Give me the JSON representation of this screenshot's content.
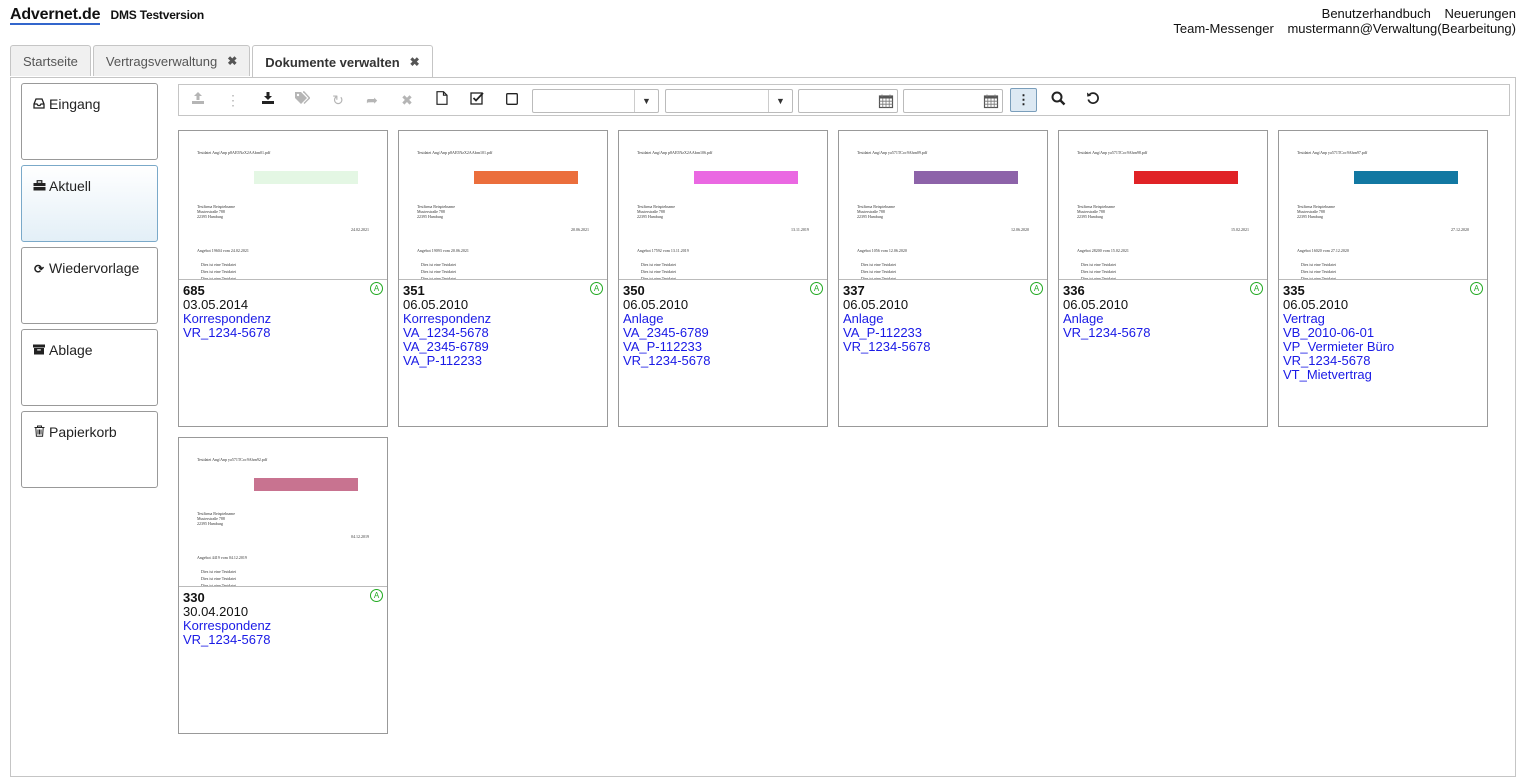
{
  "app": {
    "logo": "Advernet.de",
    "subtitle": "DMS  Testversion"
  },
  "toplinks": {
    "handbook": "Benutzerhandbuch",
    "news": "Neuerungen",
    "messenger": "Team-Messenger",
    "user": "mustermann@Verwaltung(Bearbeitung)"
  },
  "tabs": [
    {
      "label": "Startseite",
      "closable": false
    },
    {
      "label": "Vertragsverwaltung",
      "closable": true
    },
    {
      "label": "Dokumente verwalten",
      "closable": true,
      "active": true
    }
  ],
  "sidebar": [
    {
      "label": "Eingang",
      "icon": "inbox-icon"
    },
    {
      "label": "Aktuell",
      "icon": "briefcase-icon",
      "active": true
    },
    {
      "label": "Wiedervorlage",
      "icon": "refresh-icon"
    },
    {
      "label": "Ablage",
      "icon": "archive-icon"
    },
    {
      "label": "Papierkorb",
      "icon": "trash-icon"
    }
  ],
  "toolbar": {
    "filter1_value": "",
    "filter2_value": "",
    "date_from": "",
    "date_to": ""
  },
  "documents": [
    {
      "number": "685",
      "date": "03.05.2014",
      "tags": [
        "Korrespondenz",
        "VR_1234-5678"
      ],
      "color": "#e4f7e4",
      "file": "Testdatei Ang/Anp p8AE5NzX2AAbrn01.pdf",
      "angebot": "Angebot 19604 vom 24.02.2021",
      "docdate": "24.02.2021"
    },
    {
      "number": "351",
      "date": "06.05.2010",
      "tags": [
        "Korrespondenz",
        "VA_1234-5678",
        "VA_2345-6789",
        "VA_P-112233"
      ],
      "color": "#eb6e3c",
      "file": "Testdatei Ang/Anp p8AE5NzX2AAbrn101.pdf",
      "angebot": "Angebot 19093 vom 20.06.2021",
      "docdate": "20.06.2021"
    },
    {
      "number": "350",
      "date": "06.05.2010",
      "tags": [
        "Anlage",
        "VA_2345-6789",
        "VA_P-112233",
        "VR_1234-5678"
      ],
      "color": "#ea68e2",
      "file": "Testdatei Ang/Anp p8AE5NzX2AAbrn106.pdf",
      "angebot": "Angebot 17592 vom 13.11.2019",
      "docdate": "13.11.2019"
    },
    {
      "number": "337",
      "date": "06.05.2010",
      "tags": [
        "Anlage",
        "VA_P-112233",
        "VR_1234-5678"
      ],
      "color": "#8d63a9",
      "file": "Testdatei Ang/Anp ya571TCoc9Ahrn09.pdf",
      "angebot": "Angebot 1056 vom 12.06.2020",
      "docdate": "12.06.2020"
    },
    {
      "number": "336",
      "date": "06.05.2010",
      "tags": [
        "Anlage",
        "VR_1234-5678"
      ],
      "color": "#e02226",
      "file": "Testdatei Ang/Anp ya571TCoc9Ahrn98.pdf",
      "angebot": "Angebot 28200 vom 15.02.2021",
      "docdate": "15.02.2021"
    },
    {
      "number": "335",
      "date": "06.05.2010",
      "tags": [
        "Vertrag",
        "VB_2010-06-01",
        "VP_Vermieter Büro",
        "VR_1234-5678",
        "VT_Mietvertrag"
      ],
      "color": "#1278a2",
      "file": "Testdatei Ang/Anp ya571TCoc9Ahrn97.pdf",
      "angebot": "Angebot 16020 vom 27.12.2020",
      "docdate": "27.12.2020"
    },
    {
      "number": "330",
      "date": "30.04.2010",
      "tags": [
        "Korrespondenz",
        "VR_1234-5678"
      ],
      "color": "#c87390",
      "file": "Testdatei Ang/Anp ya571TCoc9Ahrn92.pdf",
      "angebot": "Angebot 4419 vom 04.12.2019",
      "docdate": "04.12.2019"
    }
  ],
  "preview_common": {
    "addr1": "Testfirma Beispielname",
    "addr2": "Musterstraße 788",
    "addr3": "22395 Hamburg",
    "body": "Dies ist eine Testdatei"
  }
}
